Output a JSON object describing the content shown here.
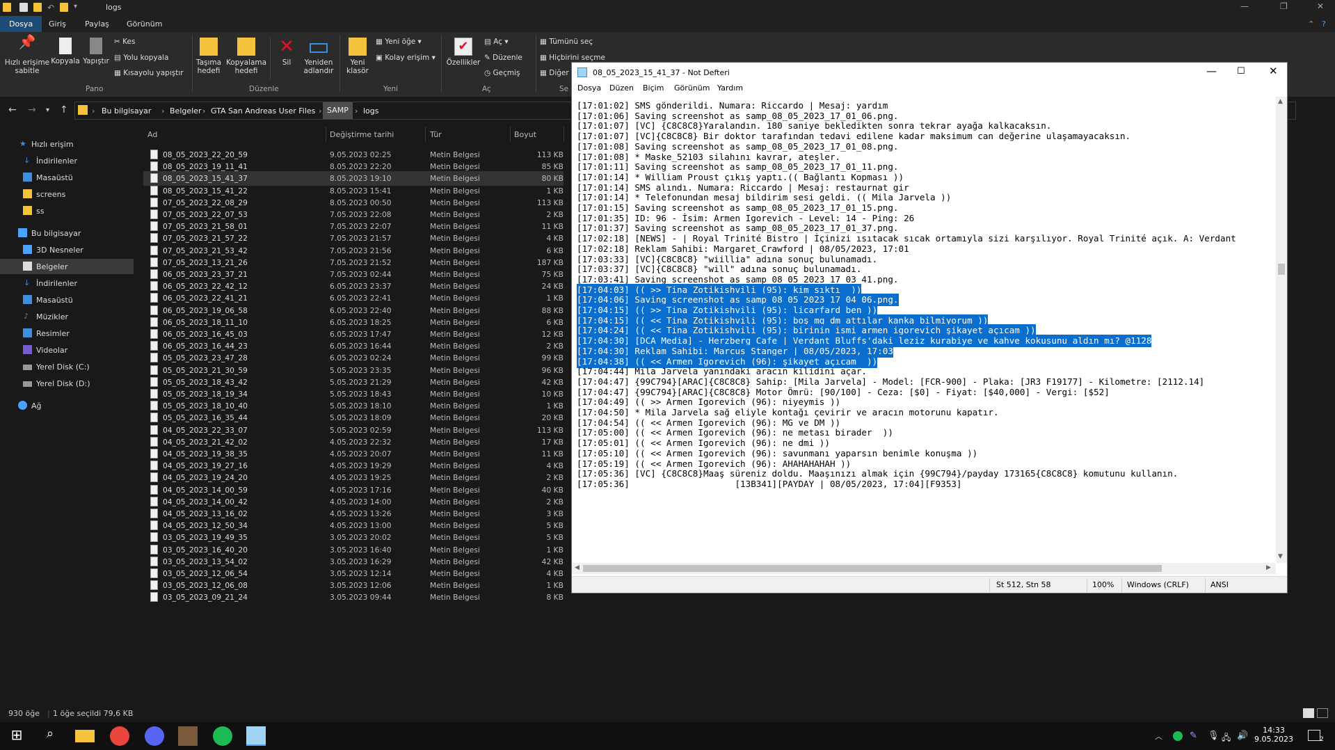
{
  "explorer": {
    "title": "logs",
    "tabs": [
      "Dosya",
      "Giriş",
      "Paylaş",
      "Görünüm"
    ],
    "ribbon": {
      "pin_label": "Hızlı erişime sabitle",
      "copy_label": "Kopyala",
      "paste_label": "Yapıştır",
      "cut_label": "Kes",
      "copy_path_label": "Yolu kopyala",
      "paste_shortcut_label": "Kısayolu yapıştır",
      "pano_group": "Pano",
      "move_to_label": "Taşıma hedefi",
      "copy_to_label": "Kopyalama hedefi",
      "delete_label": "Sil",
      "rename_label": "Yeniden adlandır",
      "duzenle_group": "Düzenle",
      "new_folder_label": "Yeni klasör",
      "new_item_label": "Yeni öğe",
      "easy_access_label": "Kolay erişim",
      "yeni_group": "Yeni",
      "properties_label": "Özellikler",
      "open_label": "Aç",
      "edit_label": "Düzenle",
      "history_label": "Geçmiş",
      "ac_group": "Aç",
      "select_all_label": "Tümünü seç",
      "select_none_label": "Hiçbirini seçme",
      "invert_label": "Diğer",
      "sec_group": "Se"
    },
    "breadcrumb": [
      "Bu bilgisayar",
      "Belgeler",
      "GTA San Andreas User Files",
      "SAMP",
      "logs"
    ],
    "nav_items": [
      {
        "label": "Hızlı erişim"
      },
      {
        "label": "İndirilenler"
      },
      {
        "label": "Masaüstü"
      },
      {
        "label": "screens"
      },
      {
        "label": "ss"
      },
      {
        "label": "Bu bilgisayar"
      },
      {
        "label": "3D Nesneler"
      },
      {
        "label": "Belgeler"
      },
      {
        "label": "İndirilenler"
      },
      {
        "label": "Masaüstü"
      },
      {
        "label": "Müzikler"
      },
      {
        "label": "Resimler"
      },
      {
        "label": "Videolar"
      },
      {
        "label": "Yerel Disk (C:)"
      },
      {
        "label": "Yerel Disk (D:)"
      },
      {
        "label": "Ağ"
      }
    ],
    "columns": {
      "name": "Ad",
      "date": "Değiştirme tarihi",
      "type": "Tür",
      "size": "Boyut"
    },
    "files": [
      {
        "name": "08_05_2023_22_20_59",
        "date": "9.05.2023 02:25",
        "type": "Metin Belgesi",
        "size": "113 KB"
      },
      {
        "name": "08_05_2023_19_11_41",
        "date": "8.05.2023 22:20",
        "type": "Metin Belgesi",
        "size": "85 KB"
      },
      {
        "name": "08_05_2023_15_41_37",
        "date": "8.05.2023 19:10",
        "type": "Metin Belgesi",
        "size": "80 KB"
      },
      {
        "name": "08_05_2023_15_41_22",
        "date": "8.05.2023 15:41",
        "type": "Metin Belgesi",
        "size": "1 KB"
      },
      {
        "name": "07_05_2023_22_08_29",
        "date": "8.05.2023 00:50",
        "type": "Metin Belgesi",
        "size": "113 KB"
      },
      {
        "name": "07_05_2023_22_07_53",
        "date": "7.05.2023 22:08",
        "type": "Metin Belgesi",
        "size": "2 KB"
      },
      {
        "name": "07_05_2023_21_58_01",
        "date": "7.05.2023 22:07",
        "type": "Metin Belgesi",
        "size": "11 KB"
      },
      {
        "name": "07_05_2023_21_57_22",
        "date": "7.05.2023 21:57",
        "type": "Metin Belgesi",
        "size": "4 KB"
      },
      {
        "name": "07_05_2023_21_53_42",
        "date": "7.05.2023 21:56",
        "type": "Metin Belgesi",
        "size": "6 KB"
      },
      {
        "name": "07_05_2023_13_21_26",
        "date": "7.05.2023 21:52",
        "type": "Metin Belgesi",
        "size": "187 KB"
      },
      {
        "name": "06_05_2023_23_37_21",
        "date": "7.05.2023 02:44",
        "type": "Metin Belgesi",
        "size": "75 KB"
      },
      {
        "name": "06_05_2023_22_42_12",
        "date": "6.05.2023 23:37",
        "type": "Metin Belgesi",
        "size": "24 KB"
      },
      {
        "name": "06_05_2023_22_41_21",
        "date": "6.05.2023 22:41",
        "type": "Metin Belgesi",
        "size": "1 KB"
      },
      {
        "name": "06_05_2023_19_06_58",
        "date": "6.05.2023 22:40",
        "type": "Metin Belgesi",
        "size": "88 KB"
      },
      {
        "name": "06_05_2023_18_11_10",
        "date": "6.05.2023 18:25",
        "type": "Metin Belgesi",
        "size": "6 KB"
      },
      {
        "name": "06_05_2023_16_45_03",
        "date": "6.05.2023 17:47",
        "type": "Metin Belgesi",
        "size": "12 KB"
      },
      {
        "name": "06_05_2023_16_44_23",
        "date": "6.05.2023 16:44",
        "type": "Metin Belgesi",
        "size": "2 KB"
      },
      {
        "name": "05_05_2023_23_47_28",
        "date": "6.05.2023 02:24",
        "type": "Metin Belgesi",
        "size": "99 KB"
      },
      {
        "name": "05_05_2023_21_30_59",
        "date": "5.05.2023 23:35",
        "type": "Metin Belgesi",
        "size": "96 KB"
      },
      {
        "name": "05_05_2023_18_43_42",
        "date": "5.05.2023 21:29",
        "type": "Metin Belgesi",
        "size": "42 KB"
      },
      {
        "name": "05_05_2023_18_19_34",
        "date": "5.05.2023 18:43",
        "type": "Metin Belgesi",
        "size": "10 KB"
      },
      {
        "name": "05_05_2023_18_10_40",
        "date": "5.05.2023 18:10",
        "type": "Metin Belgesi",
        "size": "1 KB"
      },
      {
        "name": "05_05_2023_16_35_44",
        "date": "5.05.2023 18:09",
        "type": "Metin Belgesi",
        "size": "20 KB"
      },
      {
        "name": "04_05_2023_22_33_07",
        "date": "5.05.2023 02:59",
        "type": "Metin Belgesi",
        "size": "113 KB"
      },
      {
        "name": "04_05_2023_21_42_02",
        "date": "4.05.2023 22:32",
        "type": "Metin Belgesi",
        "size": "17 KB"
      },
      {
        "name": "04_05_2023_19_38_35",
        "date": "4.05.2023 20:07",
        "type": "Metin Belgesi",
        "size": "11 KB"
      },
      {
        "name": "04_05_2023_19_27_16",
        "date": "4.05.2023 19:29",
        "type": "Metin Belgesi",
        "size": "4 KB"
      },
      {
        "name": "04_05_2023_19_24_20",
        "date": "4.05.2023 19:25",
        "type": "Metin Belgesi",
        "size": "2 KB"
      },
      {
        "name": "04_05_2023_14_00_59",
        "date": "4.05.2023 17:16",
        "type": "Metin Belgesi",
        "size": "40 KB"
      },
      {
        "name": "04_05_2023_14_00_42",
        "date": "4.05.2023 14:00",
        "type": "Metin Belgesi",
        "size": "2 KB"
      },
      {
        "name": "04_05_2023_13_16_02",
        "date": "4.05.2023 13:26",
        "type": "Metin Belgesi",
        "size": "3 KB"
      },
      {
        "name": "04_05_2023_12_50_34",
        "date": "4.05.2023 13:00",
        "type": "Metin Belgesi",
        "size": "5 KB"
      },
      {
        "name": "03_05_2023_19_49_35",
        "date": "3.05.2023 20:02",
        "type": "Metin Belgesi",
        "size": "5 KB"
      },
      {
        "name": "03_05_2023_16_40_20",
        "date": "3.05.2023 16:40",
        "type": "Metin Belgesi",
        "size": "1 KB"
      },
      {
        "name": "03_05_2023_13_54_02",
        "date": "3.05.2023 16:29",
        "type": "Metin Belgesi",
        "size": "42 KB"
      },
      {
        "name": "03_05_2023_12_06_54",
        "date": "3.05.2023 12:14",
        "type": "Metin Belgesi",
        "size": "4 KB"
      },
      {
        "name": "03_05_2023_12_06_08",
        "date": "3.05.2023 12:06",
        "type": "Metin Belgesi",
        "size": "1 KB"
      },
      {
        "name": "03_05_2023_09_21_24",
        "date": "3.05.2023 09:44",
        "type": "Metin Belgesi",
        "size": "8 KB"
      }
    ],
    "selected_index": 2,
    "status_count": "930 öğe",
    "status_selected": "1 öğe seçildi  79,6 KB"
  },
  "notepad": {
    "title": "08_05_2023_15_41_37 - Not Defteri",
    "menu": [
      "Dosya",
      "Düzen",
      "Biçim",
      "Görünüm",
      "Yardım"
    ],
    "lines": [
      "[17:01:02] SMS gönderildi. Numara: Riccardo | Mesaj: yardım",
      "[17:01:06] Saving screenshot as samp_08_05_2023_17_01_06.png.",
      "[17:01:07] [VC] {C8C8C8}Yaralandın. 180 saniye bekledikten sonra tekrar ayağa kalkacaksın.",
      "[17:01:07] [VC]{C8C8C8} Bir doktor tarafından tedavi edilene kadar maksimum can değerine ulaşamayacaksın.",
      "[17:01:08] Saving screenshot as samp_08_05_2023_17_01_08.png.",
      "[17:01:08] * Maske_52103 silahını kavrar, ateşler.",
      "[17:01:11] Saving screenshot as samp_08_05_2023_17_01_11.png.",
      "[17:01:14] * William Proust çıkış yaptı.(( Bağlantı Kopması ))",
      "[17:01:14] SMS alındı. Numara: Riccardo | Mesaj: restaurnat gir",
      "[17:01:14] * Telefonundan mesaj bildirim sesi geldi. (( Mila Jarvela ))",
      "[17:01:15] Saving screenshot as samp_08_05_2023_17_01_15.png.",
      "[17:01:35] ID: 96 - İsim: Armen Igorevich - Level: 14 - Ping: 26",
      "[17:01:37] Saving screenshot as samp_08_05_2023_17_01_37.png.",
      "[17:02:18] [NEWS] - | Royal Trinité Bistro | İçinizi ısıtacak sıcak ortamıyla sizi karşılıyor. Royal Trinité açık. A: Verdant",
      "[17:02:18] Reklam Sahibi: Margaret_Crawford | 08/05/2023, 17:01",
      "[17:03:33] [VC]{C8C8C8} \"wiillia\" adına sonuç bulunamadı.",
      "[17:03:37] [VC]{C8C8C8} \"will\" adına sonuç bulunamadı.",
      "[17:03:41] Saving screenshot as samp_08_05_2023_17_03_41.png.",
      "[17:04:03] (( >> Tina Zotikishvili (95): kim sıktı  ))",
      "[17:04:06] Saving screenshot as samp_08_05_2023_17_04_06.png.",
      "[17:04:15] (( >> Tina Zotikishvili (95): licarfard ben ))",
      "[17:04:15] (( << Tina Zotikishvili (95): boş mg dm attılar kanka bilmiyorum ))",
      "[17:04:24] (( << Tina Zotikishvili (95): birinin ismi armen igorevich şikayet açıcam ))",
      "[17:04:30] [DCA Media] - Herzberg Cafe | Verdant Bluffs'daki leziz kurabiye ve kahve kokusunu aldın mı? @1128",
      "[17:04:30] Reklam Sahibi: Marcus_Stanger | 08/05/2023, 17:03",
      "[17:04:38] (( << Armen Igorevich (96): şikayet açıcam  ))",
      "[17:04:44] Mila Jarvela yanındaki aracın kilidini açar.",
      "[17:04:47] {99C794}[ARAC]{C8C8C8} Sahip: [Mila Jarvela] - Model: [FCR-900] - Plaka: [JR3 F19177] - Kilometre: [2112.14]",
      "[17:04:47] {99C794}[ARAC]{C8C8C8} Motor Ömrü: [90/100] - Ceza: [$0] - Fiyat: [$40,000] - Vergi: [$52]",
      "[17:04:49] (( >> Armen Igorevich (96): niyeymis ))",
      "[17:04:50] * Mila Jarvela sağ eliyle kontağı çevirir ve aracın motorunu kapatır.",
      "[17:04:54] (( << Armen Igorevich (96): MG ve DM ))",
      "[17:05:00] (( << Armen Igorevich (96): ne metası birader  ))",
      "[17:05:01] (( << Armen Igorevich (96): ne dmi ))",
      "[17:05:10] (( << Armen Igorevich (96): savunmanı yaparsın benimle konuşma ))",
      "[17:05:19] (( << Armen Igorevich (96): AHAHAHAHAH ))",
      "[17:05:36] [VC] {C8C8C8}Maaş süreniz doldu. Maaşınızı almak için {99C794}/payday 173165{C8C8C8} komutunu kullanın.",
      "[17:05:36]                    [13B341][PAYDAY | 08/05/2023, 17:04][F9353]"
    ],
    "highlight_from": 18,
    "highlight_to": 25,
    "status": {
      "position": "St 512, Stn 58",
      "zoom": "100%",
      "eol": "Windows (CRLF)",
      "encoding": "ANSI"
    }
  },
  "taskbar": {
    "time": "14:33",
    "date": "9.05.2023",
    "notif_count": "2"
  },
  "colors": {
    "accent": "#0a6ecf",
    "folder": "#f5c33b"
  }
}
